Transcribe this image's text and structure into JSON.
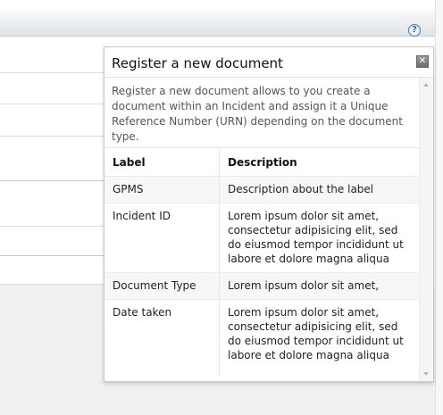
{
  "header": {
    "help_icon_glyph": "?"
  },
  "popover": {
    "title": "Register a new document",
    "close_glyph": "✕",
    "description": "Register a new document allows to you create a document within an Incident and assign it a Unique Reference Number (URN) depending on the document type.",
    "table": {
      "headers": [
        "Label",
        "Description"
      ],
      "rows": [
        {
          "label": "GPMS",
          "description": "Description about the label"
        },
        {
          "label": "Incident ID",
          "description": "Lorem ipsum dolor sit amet, consectetur adipisicing elit, sed do eiusmod tempor incididunt ut labore et dolore magna aliqua"
        },
        {
          "label": "Document Type",
          "description": "Lorem ipsum dolor sit amet,"
        },
        {
          "label": "Date taken",
          "description": "Lorem ipsum dolor sit amet, consectetur adipisicing elit, sed do eiusmod tempor incididunt ut labore et dolore magna aliqua"
        }
      ]
    }
  },
  "icons": {
    "help": "help-icon",
    "close": "close-icon",
    "scroll_up": "scroll-up-icon",
    "scroll_down": "scroll-down-icon"
  },
  "colors": {
    "header_gradient_top": "#fbfbfb",
    "header_gradient_bottom": "#dfe3e6",
    "help_icon": "#3b69a8",
    "close_button": "#6e6e6e"
  }
}
